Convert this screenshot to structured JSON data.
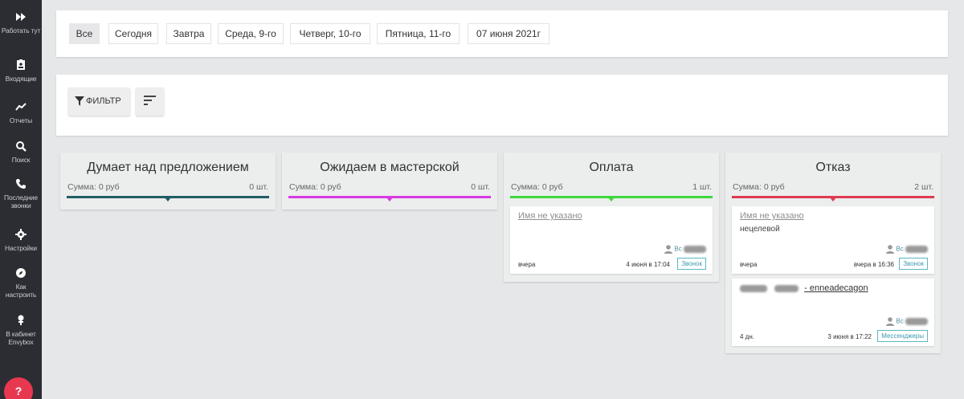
{
  "sidebar": {
    "items": [
      {
        "icon": "fast-forward-icon",
        "label": "Работать тут"
      },
      {
        "icon": "inbox-icon",
        "label": "Входящие"
      },
      {
        "icon": "chart-icon",
        "label": "Отчеты"
      },
      {
        "icon": "search-icon",
        "label": "Поиск"
      },
      {
        "icon": "phone-icon",
        "label": "Последние звонки"
      },
      {
        "icon": "gear-icon",
        "label": "Настройки"
      },
      {
        "icon": "compass-icon",
        "label": "Как настроить"
      },
      {
        "icon": "cabinet-icon",
        "label": "В кабинет Envybox"
      }
    ],
    "help_label": "?"
  },
  "date_filters": [
    "Все",
    "Сегодня",
    "Завтра",
    "Среда, 9-го",
    "Четверг, 10-го",
    "Пятница, 11-го",
    "07 июня 2021г"
  ],
  "toolbar": {
    "filter_label": "ФИЛЬТР"
  },
  "columns": [
    {
      "title": "Думает над предложением",
      "sum": "Сумма: 0 руб",
      "count": "0 шт.",
      "color": "#1f5e63"
    },
    {
      "title": "Ожидаем в мастерской",
      "sum": "Сумма: 0 руб",
      "count": "0 шт.",
      "color": "#d83ae4"
    },
    {
      "title": "Оплата",
      "sum": "Сумма: 0 руб",
      "count": "1 шт.",
      "color": "#3ed83e"
    },
    {
      "title": "Отказ",
      "sum": "Сумма: 0 руб",
      "count": "2 шт.",
      "color": "#e03a52"
    }
  ],
  "cards": {
    "payment_1": {
      "name": "Имя не указано",
      "manager": "Вс",
      "age": "вчера",
      "when": "4 июня в 17:04",
      "tag": "Звонок"
    },
    "refusal_1": {
      "name": "Имя не указано",
      "note": "нецелевой",
      "manager": "Вс",
      "age": "вчера",
      "when": "вчера в 16:36",
      "tag": "Звонок"
    },
    "refusal_2": {
      "name_suffix": "- enneadecagon",
      "manager": "Вс",
      "age": "4 дн.",
      "when": "3 июня в 17:22",
      "tag": "Мессенджеры"
    }
  }
}
